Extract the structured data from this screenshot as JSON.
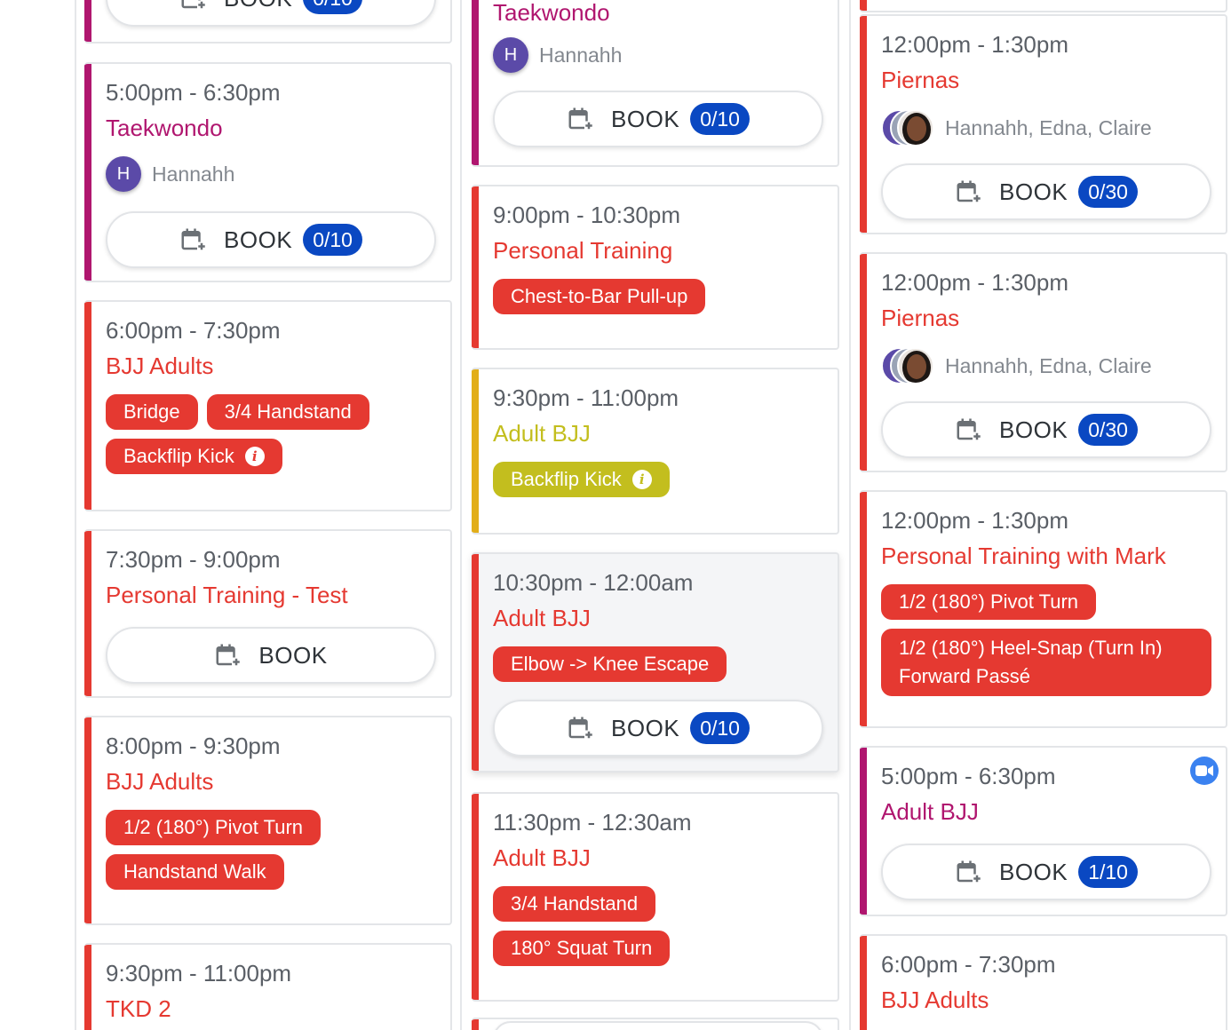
{
  "colors": {
    "red": "#e53931",
    "magenta": "#b0166f",
    "yellow": "#c3be1e",
    "badge_blue": "#0a48c2"
  },
  "book_label": "BOOK",
  "col1": {
    "c0": {
      "count": "0/10"
    },
    "c1": {
      "time": "5:00pm - 6:30pm",
      "title": "Taekwondo",
      "avatar": "H",
      "attendees": "Hannahh",
      "count": "0/10"
    },
    "c2": {
      "time": "6:00pm - 7:30pm",
      "title": "BJJ Adults",
      "tags": [
        "Bridge",
        "3/4 Handstand",
        "Backflip Kick"
      ]
    },
    "c3": {
      "time": "7:30pm - 9:00pm",
      "title": "Personal Training - Test"
    },
    "c4": {
      "time": "8:00pm - 9:30pm",
      "title": "BJJ Adults",
      "tags": [
        "1/2 (180°) Pivot Turn",
        "Handstand Walk"
      ]
    },
    "c5": {
      "time": "9:30pm - 11:00pm",
      "title": "TKD 2"
    }
  },
  "col2": {
    "c0": {
      "title": "Taekwondo",
      "avatar": "H",
      "attendees": "Hannahh",
      "count": "0/10"
    },
    "c1": {
      "time": "9:00pm - 10:30pm",
      "title": "Personal Training",
      "tags": [
        "Chest-to-Bar Pull-up"
      ]
    },
    "c2": {
      "time": "9:30pm - 11:00pm",
      "title": "Adult BJJ",
      "tags": [
        "Backflip Kick"
      ]
    },
    "c3": {
      "time": "10:30pm - 12:00am",
      "title": "Adult BJJ",
      "tags": [
        "Elbow -> Knee Escape"
      ],
      "count": "0/10"
    },
    "c4": {
      "time": "11:30pm - 12:30am",
      "title": "Adult BJJ",
      "tags": [
        "3/4 Handstand",
        "180° Squat Turn"
      ]
    }
  },
  "col3": {
    "c1": {
      "time": "12:00pm - 1:30pm",
      "title": "Piernas",
      "attendees": "Hannahh, Edna, Claire",
      "count": "0/30"
    },
    "c2": {
      "time": "12:00pm - 1:30pm",
      "title": "Piernas",
      "attendees": "Hannahh, Edna, Claire",
      "count": "0/30"
    },
    "c3": {
      "time": "12:00pm - 1:30pm",
      "title": "Personal Training with Mark",
      "tags": [
        "1/2 (180°) Pivot Turn",
        "1/2 (180°) Heel-Snap (Turn In) Forward Passé"
      ]
    },
    "c4": {
      "time": "5:00pm - 6:30pm",
      "title": "Adult BJJ",
      "count": "1/10"
    },
    "c5": {
      "time": "6:00pm - 7:30pm",
      "title": "BJJ Adults"
    }
  }
}
